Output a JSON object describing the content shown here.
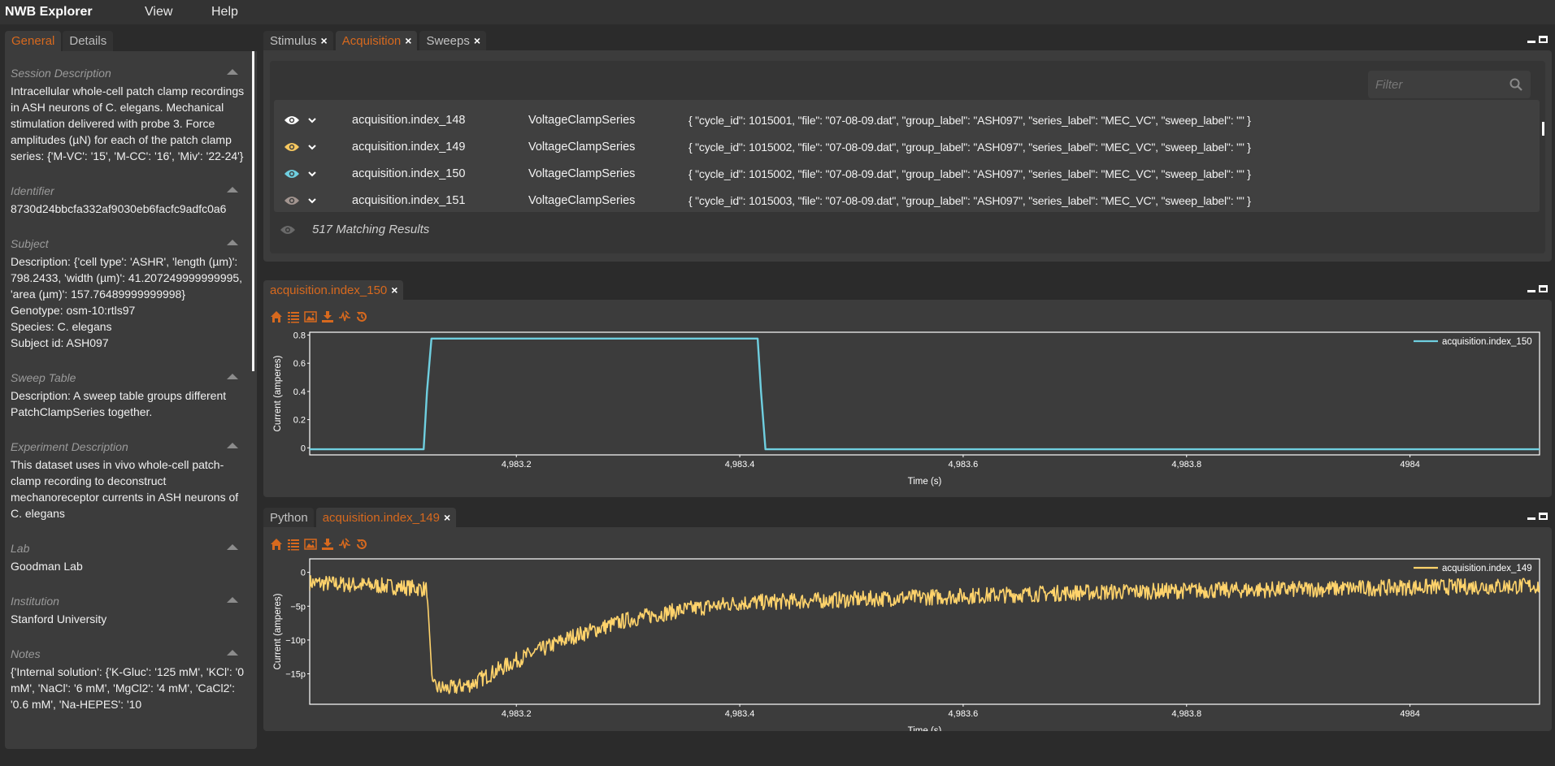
{
  "app": {
    "title": "NWB Explorer",
    "menu": [
      {
        "label": "View"
      },
      {
        "label": "Help"
      }
    ]
  },
  "sidebar": {
    "tabs": [
      {
        "label": "General",
        "active": true
      },
      {
        "label": "Details",
        "active": false
      }
    ],
    "sections": [
      {
        "title": "Session Description",
        "lines": [
          "Intracellular whole-cell patch clamp recordings in ASH neurons of C. elegans. Mechanical stimulation delivered with probe 3. Force amplitudes (µN) for each of the patch clamp series: {'M-VC': '15', 'M-CC': '16', 'Miv': '22-24'}"
        ]
      },
      {
        "title": "Identifier",
        "lines": [
          "8730d24bbcfa332af9030eb6facfc9adfc0a6"
        ]
      },
      {
        "title": "Subject",
        "lines": [
          "Description: {'cell type': 'ASHR', 'length (µm)': 798.2433, 'width (µm)': 41.207249999999995, 'area (µm)': 157.76489999999998}",
          "Genotype: osm-10:rtls97",
          "Species: C. elegans",
          "Subject id: ASH097"
        ]
      },
      {
        "title": "Sweep Table",
        "lines": [
          "Description: A sweep table groups different PatchClampSeries together."
        ]
      },
      {
        "title": "Experiment Description",
        "lines": [
          "This dataset uses in vivo whole-cell patch-clamp recording to deconstruct mechanoreceptor currents in ASH neurons of C. elegans"
        ]
      },
      {
        "title": "Lab",
        "lines": [
          "Goodman Lab"
        ]
      },
      {
        "title": "Institution",
        "lines": [
          "Stanford University"
        ]
      },
      {
        "title": "Notes",
        "lines": [
          "{'Internal solution': {'K-Gluc': '125 mM', 'KCl': '0 mM', 'NaCl': '6 mM', 'MgCl2': '4 mM', 'CaCl2': '0.6 mM', 'Na-HEPES': '10"
        ]
      }
    ]
  },
  "top_panel": {
    "tabs": [
      {
        "label": "Stimulus",
        "active": false,
        "close": "×"
      },
      {
        "label": "Acquisition",
        "active": true,
        "close": "×"
      },
      {
        "label": "Sweeps",
        "active": false,
        "close": "×"
      }
    ],
    "filter": {
      "placeholder": "Filter",
      "value": ""
    },
    "rows": [
      {
        "name": "acquisition.index_148",
        "type": "VoltageClampSeries",
        "meta": "{ \"cycle_id\": 1015001, \"file\": \"07-08-09.dat\", \"group_label\": \"ASH097\", \"series_label\": \"MEC_VC\", \"sweep_label\": \"\" }",
        "eye_color": "#ffffff"
      },
      {
        "name": "acquisition.index_149",
        "type": "VoltageClampSeries",
        "meta": "{ \"cycle_id\": 1015002, \"file\": \"07-08-09.dat\", \"group_label\": \"ASH097\", \"series_label\": \"MEC_VC\", \"sweep_label\": \"\" }",
        "eye_color": "#f6c85f"
      },
      {
        "name": "acquisition.index_150",
        "type": "VoltageClampSeries",
        "meta": "{ \"cycle_id\": 1015002, \"file\": \"07-08-09.dat\", \"group_label\": \"ASH097\", \"series_label\": \"MEC_VC\", \"sweep_label\": \"\" }",
        "eye_color": "#6fcfe0"
      },
      {
        "name": "acquisition.index_151",
        "type": "VoltageClampSeries",
        "meta": "{ \"cycle_id\": 1015003, \"file\": \"07-08-09.dat\", \"group_label\": \"ASH097\", \"series_label\": \"MEC_VC\", \"sweep_label\": \"\" }",
        "eye_color": "#a39590"
      }
    ],
    "matching_results": "517 Matching Results"
  },
  "plot_panel_1": {
    "tabs": [
      {
        "label": "acquisition.index_150",
        "active": true,
        "close": "×"
      }
    ],
    "toolbar": [
      "home-icon",
      "list-icon",
      "image-icon",
      "download-icon",
      "wave-settings-icon",
      "reset-icon"
    ]
  },
  "plot_panel_2": {
    "tabs": [
      {
        "label": "Python",
        "active": false
      },
      {
        "label": "acquisition.index_149",
        "active": true,
        "close": "×"
      }
    ],
    "toolbar": [
      "home-icon",
      "list-icon",
      "image-icon",
      "download-icon",
      "wave-settings-icon",
      "reset-icon"
    ]
  },
  "colors": {
    "accent": "#d7691e",
    "series_150": "#6fcfe0",
    "series_149": "#ffd36b"
  },
  "chart_data": [
    {
      "type": "line",
      "title": "",
      "xlabel": "Time (s)",
      "ylabel": "Current (amperes)",
      "xlim": [
        4983.015,
        4984.116
      ],
      "ylim": [
        -0.05,
        0.82
      ],
      "xticks": [
        4983.2,
        4983.4,
        4983.6,
        4983.8,
        4984
      ],
      "xtick_labels": [
        "4,983.2",
        "4,983.4",
        "4,983.6",
        "4,983.8",
        "4984"
      ],
      "yticks": [
        0,
        0.2,
        0.4,
        0.6,
        0.8
      ],
      "ytick_labels": [
        "0",
        "0.2",
        "0.4",
        "0.6",
        "0.8"
      ],
      "legend": "top-right",
      "grid": false,
      "series": [
        {
          "name": "acquisition.index_150",
          "color": "#6fcfe0",
          "x": [
            4983.015,
            4983.117,
            4983.12,
            4983.124,
            4983.416,
            4983.419,
            4983.423,
            4984.116
          ],
          "y": [
            -0.01,
            -0.01,
            0.4,
            0.775,
            0.775,
            0.4,
            -0.01,
            -0.01
          ]
        }
      ]
    },
    {
      "type": "line",
      "title": "",
      "xlabel": "Time (s)",
      "ylabel": "Current (amperes)",
      "xlim": [
        4983.015,
        4984.116
      ],
      "ylim": [
        -1.95e-11,
        2e-12
      ],
      "xticks": [
        4983.2,
        4983.4,
        4983.6,
        4983.8,
        4984
      ],
      "xtick_labels": [
        "4,983.2",
        "4,983.4",
        "4,983.6",
        "4,983.8",
        "4984"
      ],
      "yticks": [
        0,
        -5e-12,
        -1e-11,
        -1.5e-11
      ],
      "ytick_labels": [
        "0",
        "−5p",
        "−10p",
        "−15p"
      ],
      "legend": "top-right",
      "grid": false,
      "series": [
        {
          "name": "acquisition.index_149",
          "color": "#ffd36b",
          "x": [
            4983.015,
            4983.05,
            4983.08,
            4983.11,
            4983.12,
            4983.125,
            4983.14,
            4983.16,
            4983.2,
            4983.25,
            4983.3,
            4983.35,
            4983.4,
            4983.5,
            4983.6,
            4983.7,
            4983.8,
            4983.9,
            4984.0,
            4984.116
          ],
          "y": [
            -1.5e-12,
            -1.8e-12,
            -2e-12,
            -2.3e-12,
            -2.5e-12,
            -1.7e-11,
            -1.72e-11,
            -1.65e-11,
            -1.3e-11,
            -9.5e-12,
            -7e-12,
            -5.5e-12,
            -4.5e-12,
            -4e-12,
            -3.5e-12,
            -3e-12,
            -2.7e-12,
            -2.5e-12,
            -2.2e-12,
            -2e-12
          ],
          "noise_amplitude": 1.2e-12
        }
      ]
    }
  ]
}
